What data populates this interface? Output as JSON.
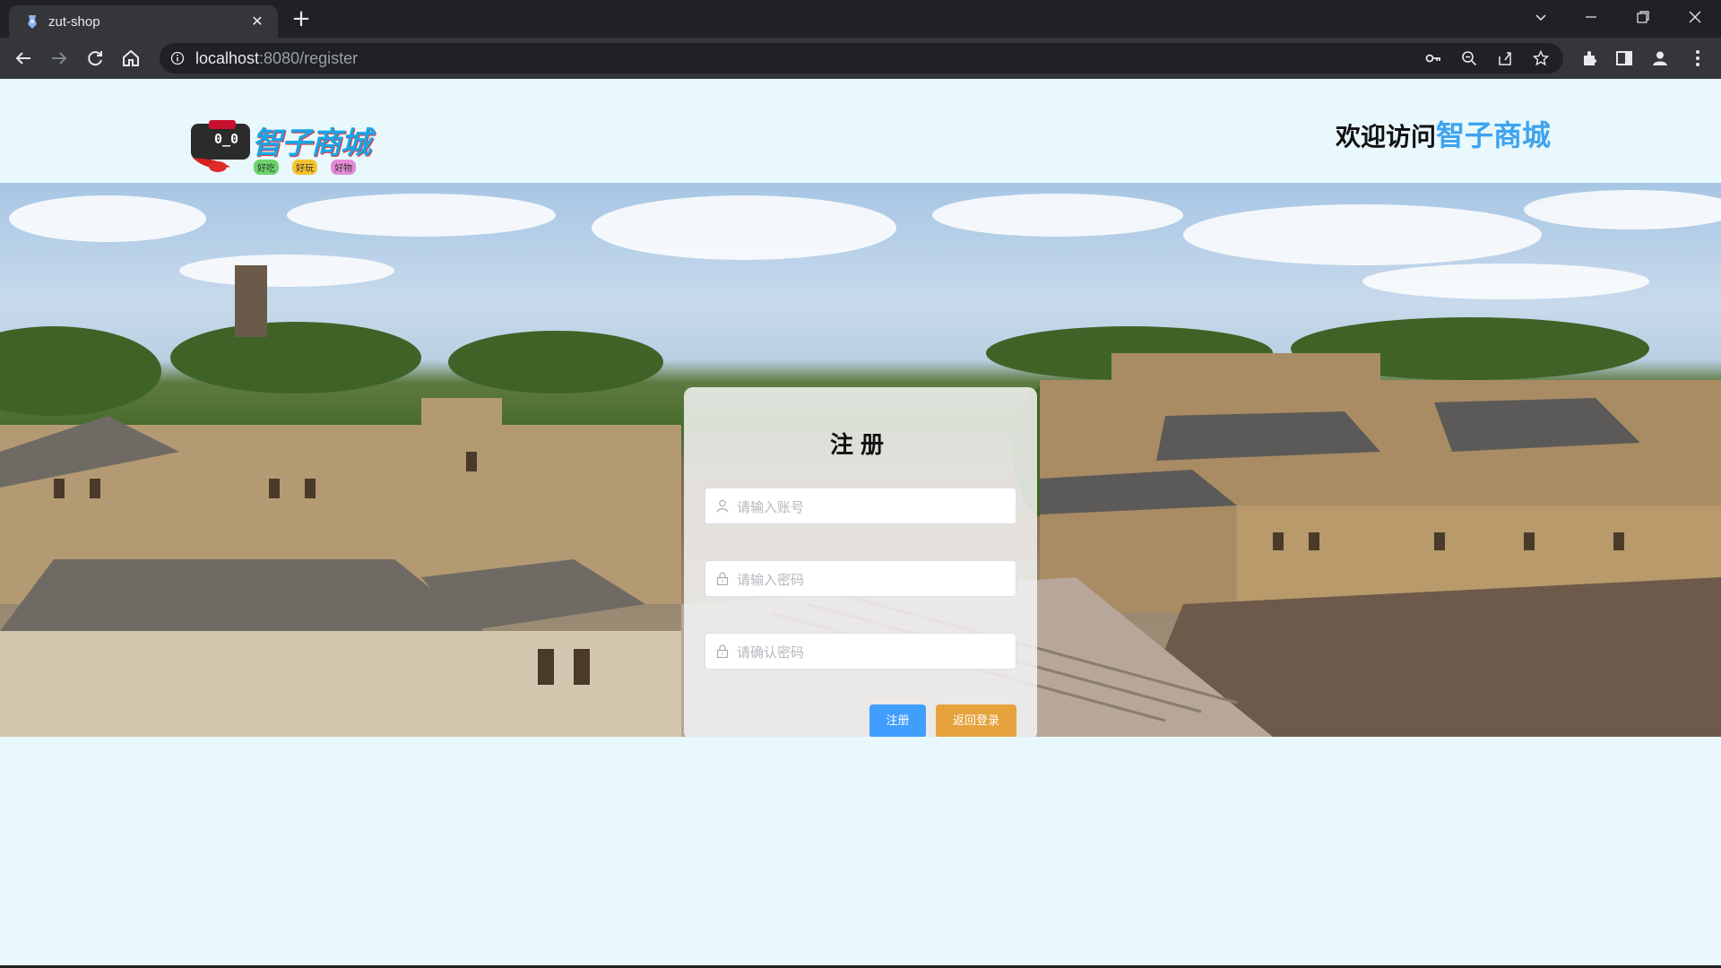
{
  "browser": {
    "tab_title": "zut-shop",
    "tab_close": "✕",
    "new_tab": "+",
    "url_host": "localhost",
    "url_rest": ":8080/register",
    "icons": [
      "back-icon",
      "forward-icon",
      "reload-icon",
      "home-icon",
      "site-info-icon",
      "key-icon",
      "zoom-icon",
      "share-icon",
      "bookmark-star-icon",
      "extensions-icon",
      "side-panel-icon",
      "profile-icon",
      "menu-icon"
    ]
  },
  "header": {
    "logo_text": "智子商城",
    "logo_tags": [
      "好吃",
      "好玩",
      "好物"
    ],
    "logo_face": "0_0",
    "welcome_prefix": "欢迎访问",
    "welcome_brand": "智子商城"
  },
  "register": {
    "title": "注册",
    "username_placeholder": "请输入账号",
    "password_placeholder": "请输入密码",
    "confirm_placeholder": "请确认密码",
    "register_label": "注册",
    "back_label": "返回登录"
  },
  "colors": {
    "page_bg": "#e8f8fd",
    "brand_blue": "#3ea3ee",
    "primary_button": "#409eff",
    "warning_button": "#e6a23c"
  }
}
